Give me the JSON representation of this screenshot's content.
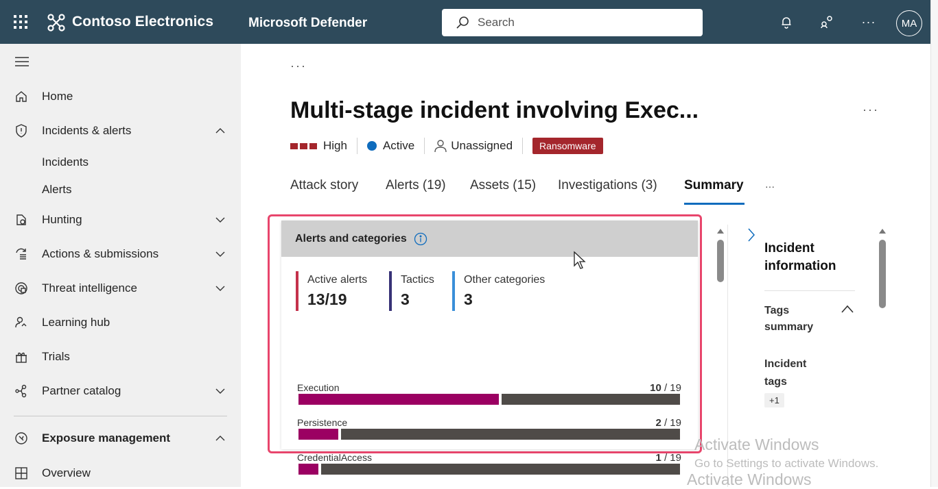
{
  "topbar": {
    "org_name": "Contoso Electronics",
    "product_name": "Microsoft Defender",
    "search_placeholder": "Search",
    "avatar_initials": "MA",
    "more_label": "···"
  },
  "sidebar": {
    "items": [
      {
        "label": "Home",
        "icon": "home-icon"
      },
      {
        "label": "Incidents & alerts",
        "icon": "shield-icon",
        "expanded": true
      },
      {
        "label": "Hunting",
        "icon": "hunting-icon"
      },
      {
        "label": "Actions & submissions",
        "icon": "actions-icon"
      },
      {
        "label": "Threat intelligence",
        "icon": "threat-intel-icon"
      },
      {
        "label": "Learning hub",
        "icon": "learning-hub-icon"
      },
      {
        "label": "Trials",
        "icon": "trials-icon"
      },
      {
        "label": "Partner catalog",
        "icon": "partner-catalog-icon"
      },
      {
        "label": "Exposure management",
        "icon": "exposure-icon",
        "expanded": true
      },
      {
        "label": "Overview",
        "icon": "overview-icon"
      }
    ],
    "sub_items": [
      "Incidents",
      "Alerts"
    ]
  },
  "page": {
    "breadcrumb_more": "···",
    "title": "Multi-stage incident involving Exec...",
    "title_more": "···",
    "severity": "High",
    "severity_color": "#a4262c",
    "status": "Active",
    "status_color": "#0f6cbd",
    "assignee": "Unassigned",
    "tag": "Ransomware"
  },
  "tabs": [
    {
      "label": "Attack story"
    },
    {
      "label": "Alerts (19)"
    },
    {
      "label": "Assets (15)"
    },
    {
      "label": "Investigations (3)"
    },
    {
      "label": "Summary",
      "active": true
    },
    {
      "label": "···"
    }
  ],
  "card": {
    "title": "Alerts and categories",
    "stats": [
      {
        "label": "Active alerts",
        "value": "13/19",
        "color": "#c4314b"
      },
      {
        "label": "Tactics",
        "value": "3",
        "color": "#373277"
      },
      {
        "label": "Other categories",
        "value": "3",
        "color": "#3a8fd9"
      }
    ],
    "categories": [
      {
        "name": "Execution",
        "count": "10",
        "total": "/ 19",
        "fraction": 0.526
      },
      {
        "name": "Persistence",
        "count": "2",
        "total": "/ 19",
        "fraction": 0.105
      },
      {
        "name": "CredentialAccess",
        "count": "1",
        "total": "/ 19",
        "fraction": 0.053
      }
    ],
    "fill_color": "#9b0062",
    "rest_color": "#4f4b48"
  },
  "side_panel": {
    "title": "Incident information",
    "tags_summary": "Tags summary",
    "incident_tags": "Incident tags",
    "plus_badge": "+1"
  },
  "watermark": {
    "line1": "Activate Windows",
    "line2": "Go to Settings to activate Windows.",
    "line3": "Activate Windows"
  }
}
